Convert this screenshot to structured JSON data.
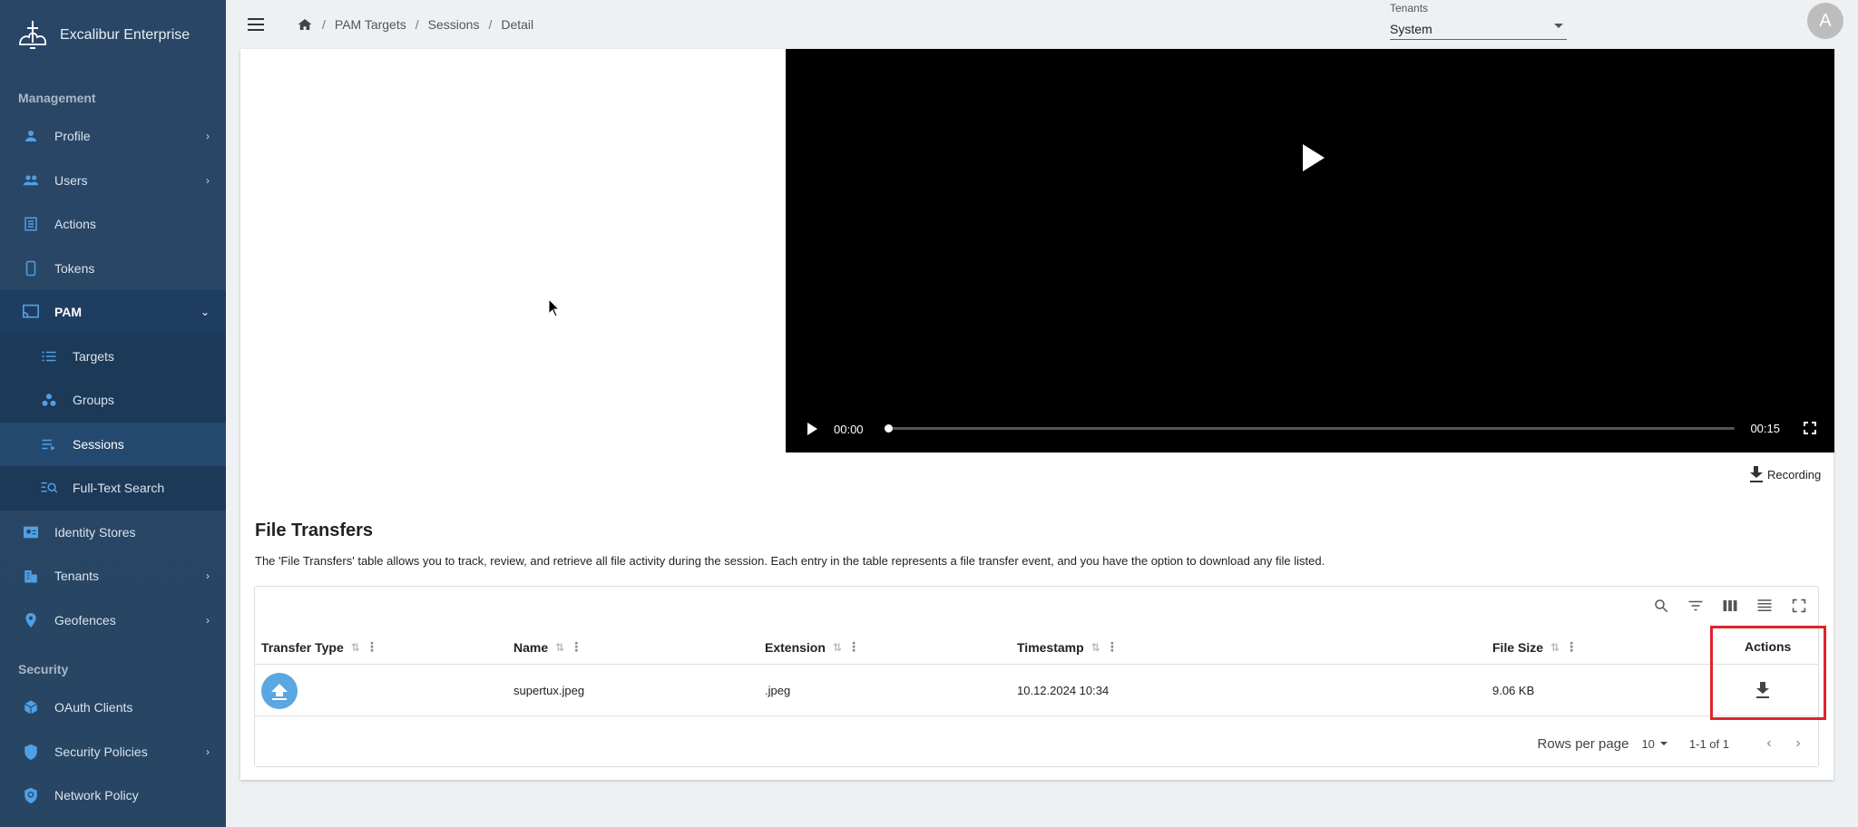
{
  "app": {
    "name": "Excalibur Enterprise"
  },
  "sidebar": {
    "management_label": "Management",
    "security_label": "Security",
    "items": [
      {
        "label": "Profile",
        "icon": "person-icon",
        "has_chevron": true
      },
      {
        "label": "Users",
        "icon": "users-icon",
        "has_chevron": true
      },
      {
        "label": "Actions",
        "icon": "actions-icon",
        "has_chevron": false
      },
      {
        "label": "Tokens",
        "icon": "phone-icon",
        "has_chevron": false
      },
      {
        "label": "PAM",
        "icon": "cast-icon",
        "expanded": true
      }
    ],
    "pam_sub": [
      {
        "label": "Targets",
        "icon": "list-icon"
      },
      {
        "label": "Groups",
        "icon": "groups-icon"
      },
      {
        "label": "Sessions",
        "icon": "playlist-icon",
        "active": true
      },
      {
        "label": "Full-Text Search",
        "icon": "search-list-icon"
      }
    ],
    "more_items": [
      {
        "label": "Identity Stores",
        "icon": "contact-icon",
        "has_chevron": false
      },
      {
        "label": "Tenants",
        "icon": "building-icon",
        "has_chevron": true
      },
      {
        "label": "Geofences",
        "icon": "pin-icon",
        "has_chevron": true
      }
    ],
    "security_items": [
      {
        "label": "OAuth Clients",
        "icon": "cube-icon",
        "has_chevron": false
      },
      {
        "label": "Security Policies",
        "icon": "shield-icon",
        "has_chevron": true
      },
      {
        "label": "Network Policy",
        "icon": "shield-search-icon",
        "has_chevron": false
      }
    ]
  },
  "topbar": {
    "breadcrumb": [
      "PAM Targets",
      "Sessions",
      "Detail"
    ],
    "tenants_label": "Tenants",
    "tenant_value": "System",
    "avatar_initial": "A"
  },
  "video": {
    "current_time": "00:00",
    "duration": "00:15",
    "progress": 0
  },
  "recording_button": "Recording",
  "file_transfers": {
    "title": "File Transfers",
    "description": "The 'File Transfers' table allows you to track, review, and retrieve all file activity during the session. Each entry in the table represents a file transfer event, and you have the option to download any file listed.",
    "columns": [
      "Transfer Type",
      "Name",
      "Extension",
      "Timestamp",
      "File Size",
      "Actions"
    ],
    "rows": [
      {
        "transfer_type_icon": "upload-icon",
        "name": "supertux.jpeg",
        "extension": ".jpeg",
        "timestamp": "10.12.2024 10:34",
        "file_size": "9.06 KB"
      }
    ],
    "pagination": {
      "rows_per_page_label": "Rows per page",
      "rows_per_page": "10",
      "range": "1-1 of 1"
    }
  },
  "colors": {
    "sidebar_bg": "#2a4666",
    "accent": "#4fa0e6",
    "highlight": "#e0242c"
  }
}
